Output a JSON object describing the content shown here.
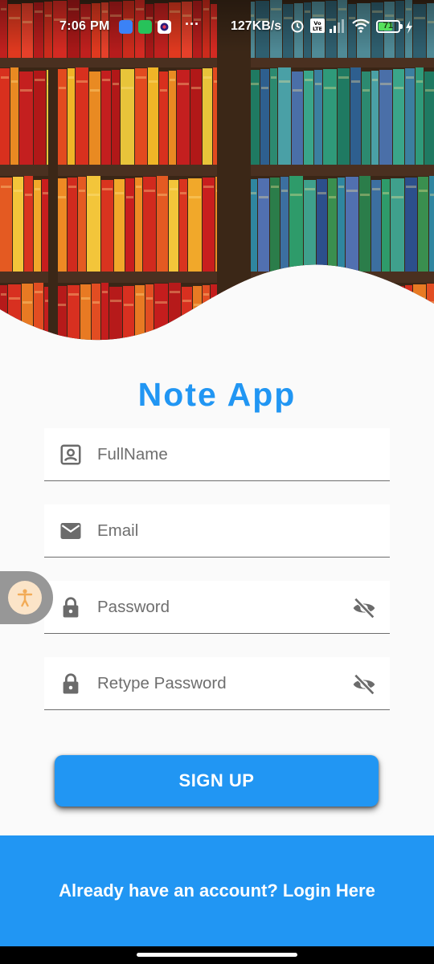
{
  "status_bar": {
    "time": "7:06 PM",
    "notifications": [
      "messages-icon",
      "wechat-icon",
      "app-icon"
    ],
    "more": "···",
    "network_speed": "127KB/s",
    "battery_level": "71",
    "battery_fraction": 0.71
  },
  "app": {
    "title": "Note App",
    "accent_color": "#2196f3"
  },
  "form": {
    "fullname_placeholder": "FullName",
    "email_placeholder": "Email",
    "password_placeholder": "Password",
    "retype_password_placeholder": "Retype Password",
    "signup_label": "SIGN UP"
  },
  "footer": {
    "login_link": "Already have an account? Login Here"
  }
}
